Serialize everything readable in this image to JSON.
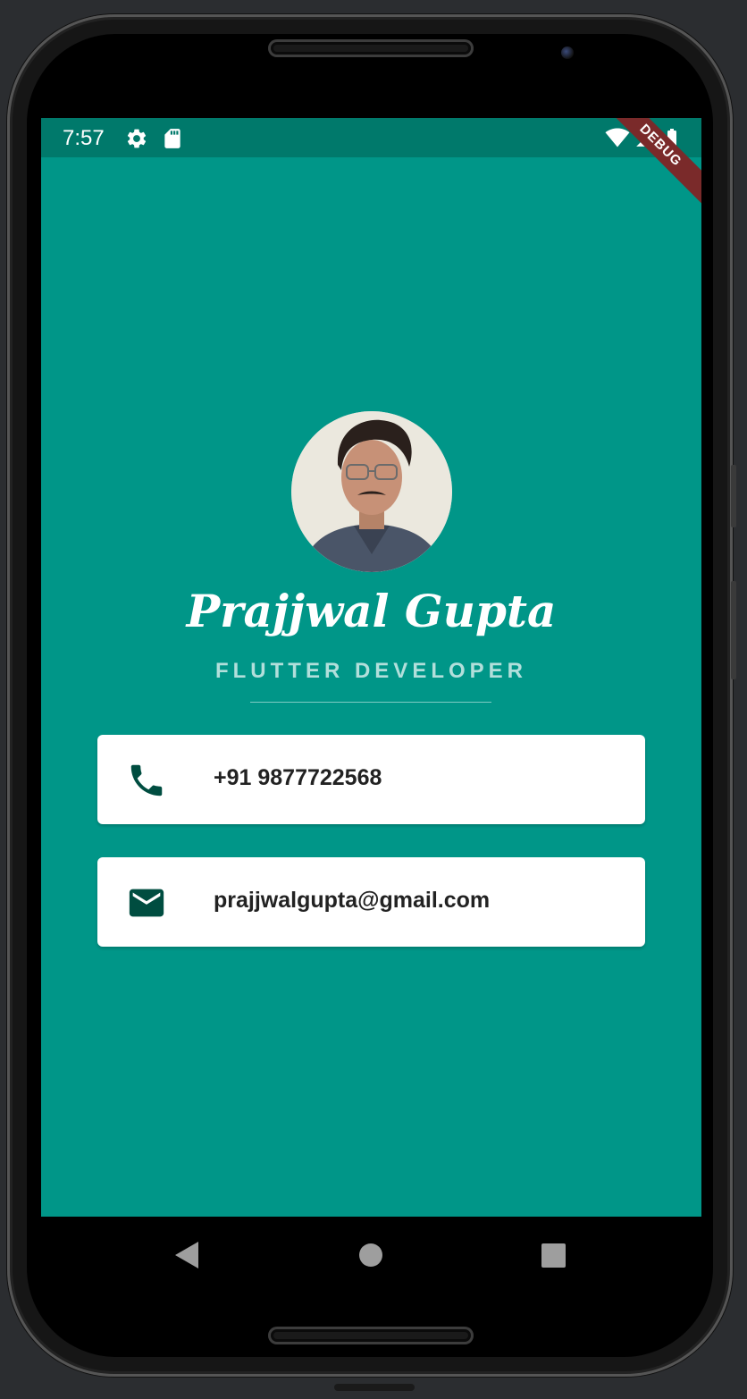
{
  "status_bar": {
    "time": "7:57",
    "left_icons": [
      "gear-icon",
      "sd-card-icon"
    ],
    "right_icons": [
      "wifi-icon",
      "signal-icon",
      "battery-icon"
    ]
  },
  "debug_banner": "DEBUG",
  "profile": {
    "name": "Prajjwal Gupta",
    "title": "FLUTTER DEVELOPER"
  },
  "contacts": [
    {
      "icon": "phone-icon",
      "value": "+91 9877722568"
    },
    {
      "icon": "mail-icon",
      "value": "prajjwalgupta@gmail.com"
    }
  ],
  "nav_bar": {
    "buttons": [
      "back-icon",
      "home-icon",
      "recents-icon"
    ]
  },
  "colors": {
    "background": "#009688",
    "status_bar": "#00796b",
    "subtitle": "#b2dfdb",
    "icon": "#004d40",
    "card": "#ffffff"
  }
}
